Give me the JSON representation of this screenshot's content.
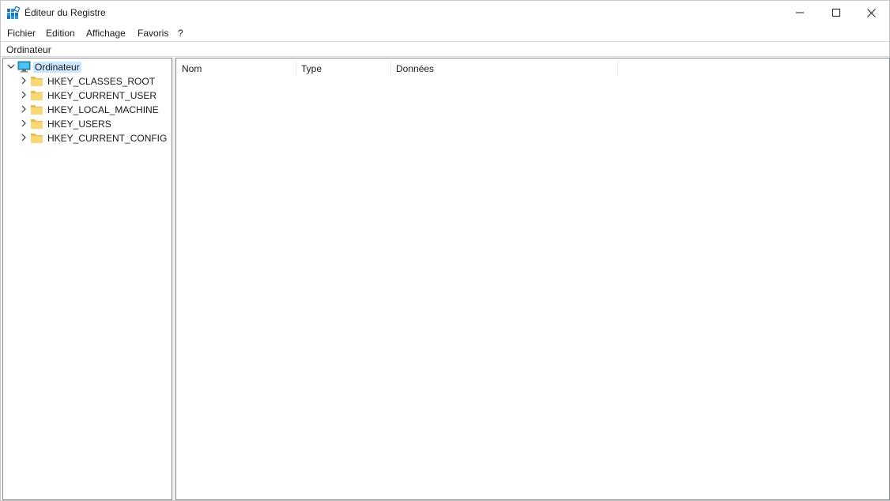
{
  "window": {
    "title": "Éditeur du Registre",
    "controls": {
      "minimize_icon": "minimize-icon",
      "maximize_icon": "maximize-icon",
      "close_icon": "close-icon"
    }
  },
  "menu": {
    "items": [
      {
        "label": "Fichier"
      },
      {
        "label": "Edition"
      },
      {
        "label": "Affichage"
      },
      {
        "label": "Favoris"
      },
      {
        "label": "?"
      }
    ]
  },
  "address": {
    "path": "Ordinateur"
  },
  "tree": {
    "root": {
      "label": "Ordinateur",
      "icon": "computer-icon",
      "expanded": true,
      "selected": true
    },
    "children": [
      {
        "label": "HKEY_CLASSES_ROOT",
        "icon": "folder-icon"
      },
      {
        "label": "HKEY_CURRENT_USER",
        "icon": "folder-icon"
      },
      {
        "label": "HKEY_LOCAL_MACHINE",
        "icon": "folder-icon"
      },
      {
        "label": "HKEY_USERS",
        "icon": "folder-icon"
      },
      {
        "label": "HKEY_CURRENT_CONFIG",
        "icon": "folder-icon"
      }
    ]
  },
  "list": {
    "columns": [
      {
        "label": "Nom"
      },
      {
        "label": "Type"
      },
      {
        "label": "Données"
      }
    ]
  },
  "colors": {
    "selection": "#cce8ff",
    "folder": "#f8d775",
    "computer": "#2aa7d8"
  }
}
